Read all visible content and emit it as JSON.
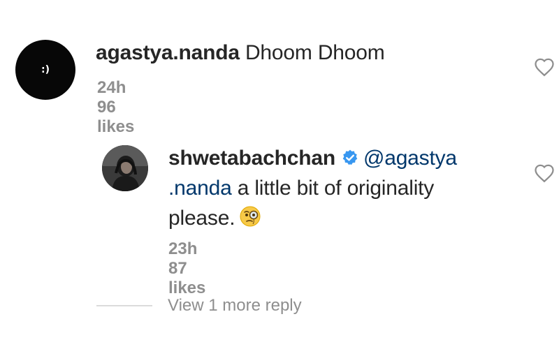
{
  "comments": [
    {
      "avatar_text": ":)",
      "username": "agastya.nanda",
      "text": "Dhoom Dhoom",
      "time": "24h",
      "likes": "96 likes"
    },
    {
      "username": "shwetabachchan",
      "verified": true,
      "mention": "@agastya .nanda",
      "text": " a little bit of originality please.",
      "emoji": "face-with-monocle",
      "time": "23h",
      "likes": "87 likes"
    }
  ],
  "more_replies": "View 1 more reply",
  "colors": {
    "text": "#262626",
    "meta": "#8e8e8e",
    "mention": "#00376b",
    "verified": "#3897f0"
  }
}
